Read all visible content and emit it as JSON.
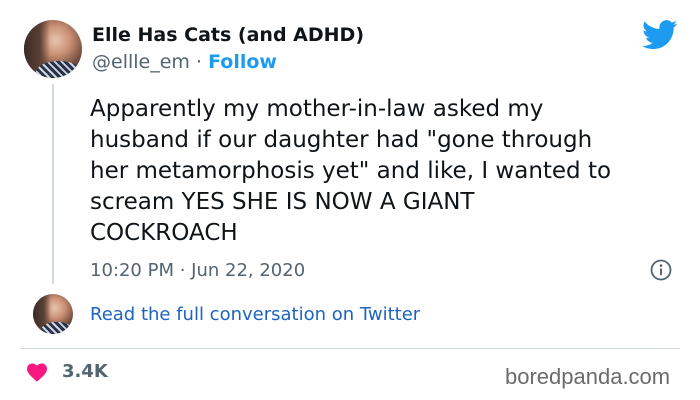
{
  "author": {
    "name": "Elle Has Cats (and ADHD)",
    "handle": "@ellle_em",
    "separator": "·",
    "follow_label": "Follow",
    "avatar_icon": "profile-photo"
  },
  "tweet": {
    "text": "Apparently my mother-in-law asked my\nhusband if our daughter had \"gone through\nher metamorphosis yet\" and like, I wanted to\nscream YES SHE IS NOW A GIANT\nCOCKROACH",
    "timestamp": "10:20 PM · Jun 22, 2020"
  },
  "conversation": {
    "link_label": "Read the full conversation on Twitter"
  },
  "engagement": {
    "likes": "3.4K"
  },
  "watermark": "boredpanda.com",
  "colors": {
    "twitter_blue": "#1d9bf0",
    "link_blue": "#1d63c1",
    "heart_red": "#f91880",
    "muted": "#536471"
  },
  "icons": {
    "brand": "twitter-bird-icon",
    "info": "info-icon",
    "like": "heart-icon"
  }
}
